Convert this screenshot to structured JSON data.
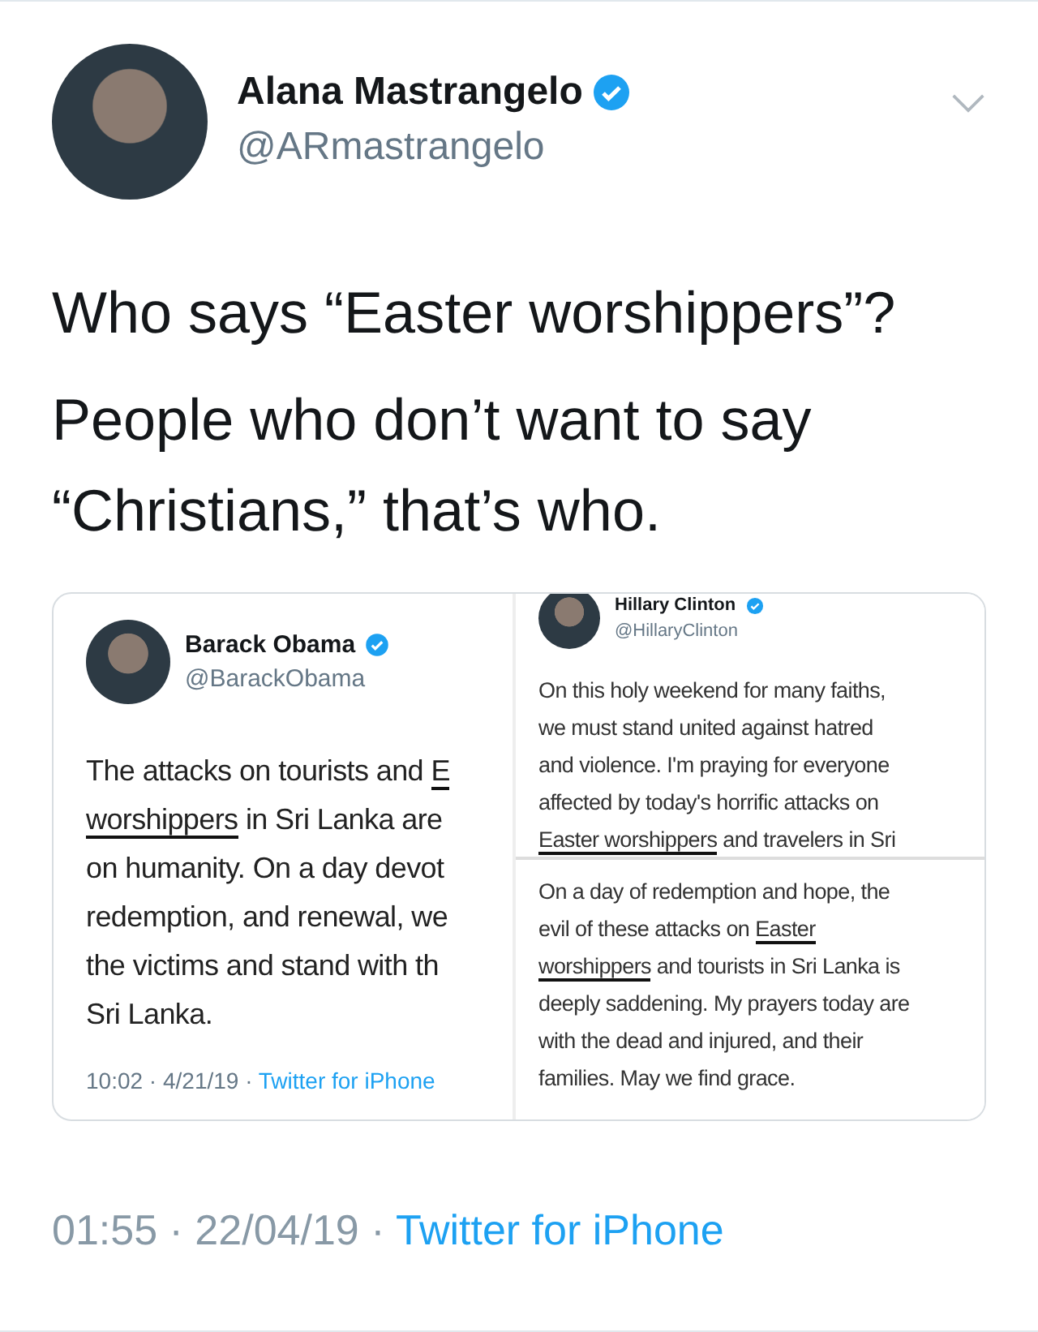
{
  "author": {
    "name": "Alana Mastrangelo",
    "handle": "@ARmastrangelo",
    "verified": true
  },
  "text": [
    "Who says “Easter worshippers”?",
    "People who don’t want to say “Christians,” that’s who."
  ],
  "embedded_left": {
    "name": "Barack Obama",
    "handle": "@BarackObama",
    "verified": true,
    "lines": [
      [
        {
          "text": "The attacks on tourists and "
        },
        {
          "text": "E",
          "marked": true
        }
      ],
      [
        {
          "text": "worshippers",
          "marked": true
        },
        {
          "text": " in Sri Lanka are"
        }
      ],
      [
        {
          "text": "on humanity. On a day devot"
        }
      ],
      [
        {
          "text": "redemption, and renewal, we"
        }
      ],
      [
        {
          "text": "the victims and stand with th"
        }
      ],
      [
        {
          "text": "Sri Lanka."
        }
      ]
    ],
    "time": "10:02 · 4/21/19 · ",
    "source": "Twitter for iPhone"
  },
  "embedded_right_top": {
    "name": "Hillary Clinton",
    "handle": "@HillaryClinton",
    "verified": true,
    "lines": [
      [
        {
          "text": "On this holy weekend for many faiths,"
        }
      ],
      [
        {
          "text": "we must stand united against hatred"
        }
      ],
      [
        {
          "text": "and violence. I'm praying for everyone"
        }
      ],
      [
        {
          "text": "affected by today's horrific attacks on"
        }
      ],
      [
        {
          "text": "Easter worshippers",
          "marked": true
        },
        {
          "text": " and travelers in Sri"
        }
      ]
    ]
  },
  "embedded_right_bottom": {
    "lines": [
      [
        {
          "text": "On a day of redemption and hope, the"
        }
      ],
      [
        {
          "text": "evil of these attacks on "
        },
        {
          "text": "Easter",
          "marked": true
        }
      ],
      [
        {
          "text": "worshippers",
          "marked": true
        },
        {
          "text": " and tourists in Sri Lanka is"
        }
      ],
      [
        {
          "text": "deeply saddening. My prayers today are"
        }
      ],
      [
        {
          "text": "with the dead and injured, and their"
        }
      ],
      [
        {
          "text": "families. May we find grace."
        }
      ]
    ]
  },
  "timestamp": "01:55 · 22/04/19 · ",
  "source": "Twitter for iPhone"
}
